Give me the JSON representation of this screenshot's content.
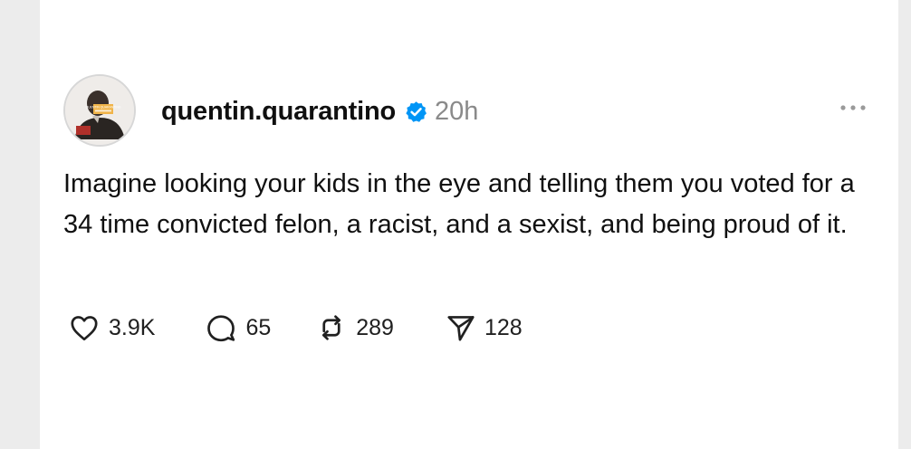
{
  "post": {
    "author": {
      "username": "quentin.quarantino",
      "verified": true,
      "avatar_icon": "avatar-person-icon",
      "avatar_overlay_text": "QUENTIN QUARANTINO"
    },
    "timestamp": "20h",
    "more_icon": "more-dots-icon",
    "text": "Imagine looking your kids in the eye and telling them you voted for a 34 time convicted felon, a racist, and a sexist, and being proud of it."
  },
  "actions": {
    "like": {
      "icon": "heart-icon",
      "count": "3.9K"
    },
    "reply": {
      "icon": "comment-icon",
      "count": "65"
    },
    "repost": {
      "icon": "repost-icon",
      "count": "289"
    },
    "share": {
      "icon": "send-icon",
      "count": "128"
    }
  },
  "colors": {
    "background": "#ececec",
    "card": "#ffffff",
    "text": "#101010",
    "muted": "#8a8a8a",
    "verified": "#0095f6"
  }
}
